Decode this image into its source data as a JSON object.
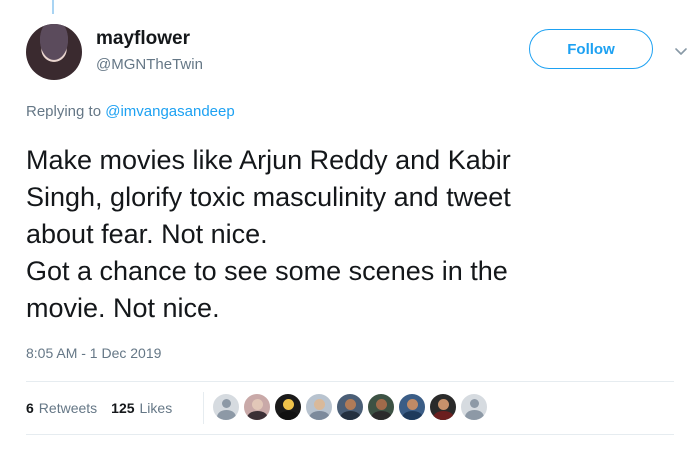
{
  "tweet": {
    "author": {
      "display_name": "mayflower",
      "handle": "@MGNTheTwin"
    },
    "follow_label": "Follow",
    "replying_prefix": "Replying to ",
    "replying_to": "@imvangasandeep",
    "text": "Make movies like Arjun Reddy and Kabir\nSingh, glorify toxic masculinity and tweet\nabout fear. Not nice.\nGot a chance to see some scenes in the\nmovie. Not nice.",
    "timestamp": "8:05 AM - 1 Dec 2019",
    "stats": {
      "retweets_count": "6",
      "retweets_label": "Retweets",
      "likes_count": "125",
      "likes_label": "Likes"
    }
  },
  "colors": {
    "accent": "#1da1f2",
    "secondary_text": "#657786",
    "primary_text": "#14171a",
    "divider": "#e6ecf0"
  },
  "icons": {
    "more": "chevron-down-icon",
    "default_avatar": "default-avatar-icon"
  }
}
